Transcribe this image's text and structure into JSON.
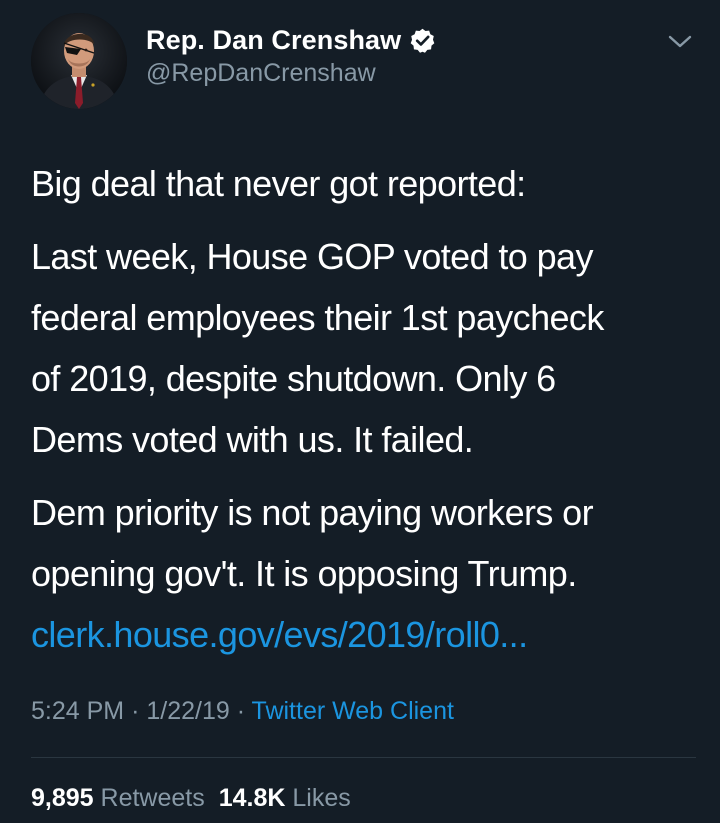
{
  "author": {
    "display_name": "Rep. Dan Crenshaw",
    "handle": "@RepDanCrenshaw",
    "verified": true,
    "avatar_icon": "profile-photo"
  },
  "menu_icon": "chevron-down-icon",
  "tweet": {
    "paragraph1": [
      "Big deal that never got reported:"
    ],
    "paragraph2": [
      "Last week, House GOP voted to pay",
      "federal employees their 1st paycheck",
      "of 2019, despite shutdown. Only 6",
      "Dems voted with us. It failed."
    ],
    "paragraph3": [
      "Dem priority is not paying workers or",
      "opening gov't. It is opposing Trump."
    ],
    "link": "clerk.house.gov/evs/2019/roll0..."
  },
  "meta": {
    "time": "5:24 PM",
    "date": "1/22/19",
    "separator": "·",
    "source": "Twitter Web Client"
  },
  "stats": {
    "retweets_count": "9,895",
    "retweets_label": "Retweets",
    "likes_count": "14.8K",
    "likes_label": "Likes"
  },
  "colors": {
    "background": "#141d26",
    "text": "#ffffff",
    "secondary": "#8899a6",
    "link": "#1b95e0"
  }
}
